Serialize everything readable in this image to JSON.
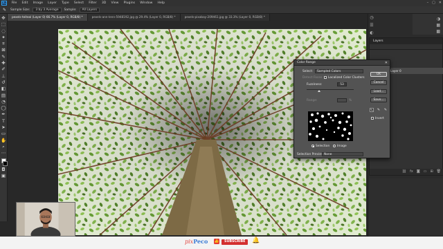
{
  "menu": {
    "logo": "Ps",
    "items": [
      "File",
      "Edit",
      "Image",
      "Layer",
      "Type",
      "Select",
      "Filter",
      "3D",
      "View",
      "Plugins",
      "Window",
      "Help"
    ]
  },
  "options": {
    "sample_size_label": "Sample Size:",
    "sample_size_value": "3 by 3 Average",
    "sample_label": "Sample:",
    "sample_value": "All Layers"
  },
  "tabs": [
    "pexels-teiteal (Layer 0) 66.7% (Layer 0, RGB/8) *",
    "pexels-ann-lenn-5948192.jpg @ 29.4% (Layer 0, RGB/8) *",
    "pexels-pixabay-209461.jpg @ 33.3% (Layer 0, RGB/8) *"
  ],
  "layers_panel": {
    "tab": "Layers",
    "layer_name": "Layer 0"
  },
  "dialog": {
    "title": "Color Range",
    "select_label": "Select:",
    "select_value": "Sampled Colors",
    "detect_faces": "Detect Faces",
    "localized_clusters": "Localized Color Clusters",
    "fuzziness_label": "Fuzziness:",
    "fuzziness_value": "53",
    "range_label": "Range:",
    "range_unit": "%",
    "radio_selection": "Selection",
    "radio_image": "Image",
    "selection_preview_label": "Selection Preview:",
    "selection_preview_value": "None",
    "ok": "OK",
    "cancel": "Cancel",
    "load": "Load...",
    "save": "Save...",
    "invert": "Invert",
    "fuzziness_level": 0.27
  },
  "branding": {
    "name_part1": "pix",
    "name_part2": "Peco",
    "subscribe": "SUBSCRIBE"
  },
  "colors": {
    "accent": "#31a8ff",
    "subscribe_red": "#d32f2f"
  }
}
